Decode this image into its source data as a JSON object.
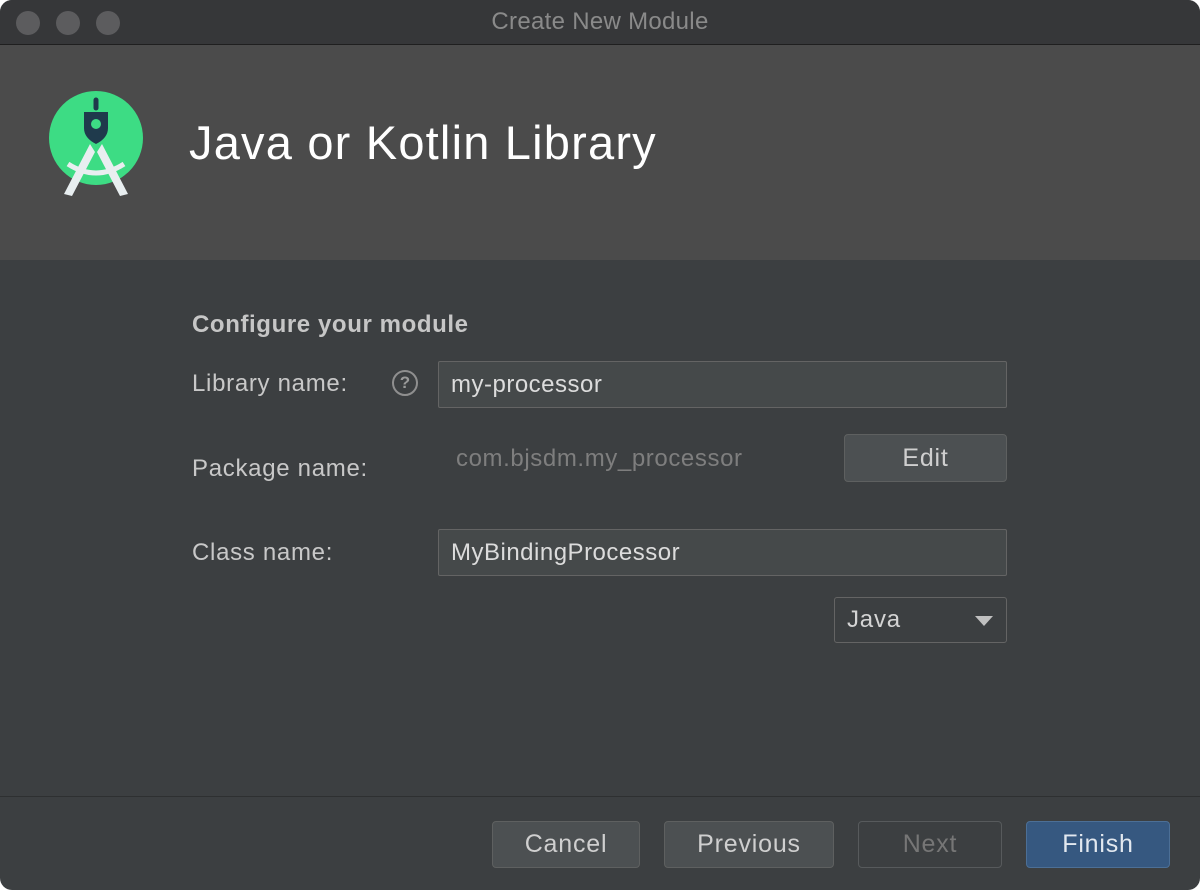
{
  "window": {
    "title": "Create New Module"
  },
  "header": {
    "title": "Java or Kotlin Library",
    "logo_icon": "android-studio-logo-icon"
  },
  "form": {
    "section_title": "Configure your module",
    "library_name": {
      "label": "Library name:",
      "value": "my-processor",
      "help_glyph": "?"
    },
    "package_name": {
      "label": "Package name:",
      "value": "com.bjsdm.my_processor",
      "edit_label": "Edit"
    },
    "class_name": {
      "label": "Class name:",
      "value": "MyBindingProcessor"
    },
    "language": {
      "selected": "Java"
    }
  },
  "footer": {
    "cancel_label": "Cancel",
    "previous_label": "Previous",
    "next_label": "Next",
    "finish_label": "Finish"
  },
  "colors": {
    "accent": "#365880",
    "logo_green": "#3ddc84",
    "window_bg": "#3c3f41",
    "header_bg": "#4b4b4b"
  }
}
